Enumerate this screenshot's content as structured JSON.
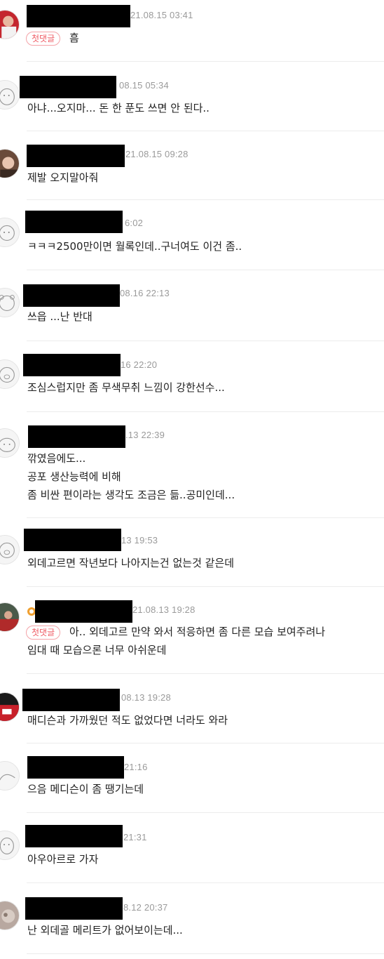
{
  "badge_label": "첫댓글",
  "comments": [
    {
      "time": "21.08.15 03:41",
      "first_comment": true,
      "text": "흠"
    },
    {
      "time": "08.15 05:34",
      "text": "아냐...오지마... 돈 한 푼도 쓰면 안 된다.."
    },
    {
      "time": "21.08.15 09:28",
      "text": "제발 오지말아줘"
    },
    {
      "time": "6:02",
      "text": "ㅋㅋㅋ2500만이면 월록인데..구너여도 이건 좀.."
    },
    {
      "time": "08.16 22:13",
      "text": "쓰읍 ...난 반대"
    },
    {
      "time": "16 22:20",
      "text": "조심스럽지만 좀 무색무취 느낌이 강한선수..."
    },
    {
      "time": ".13 22:39",
      "lines": [
        "깎였음에도...",
        "공포 생산능력에 비해",
        "좀 비싼 편이라는 생각도 조금은 듦..공미인데..."
      ]
    },
    {
      "time": "13 19:53",
      "text": "외데고르면 작년보다 나아지는건 없는것 같은데"
    },
    {
      "time": "21.08.13 19:28",
      "first_comment": true,
      "text": "아.. 외데고르 만약 와서 적응하면 좀 다른 모습 보여주려나",
      "text2": "임대 때 모습으론 너무 아쉬운데"
    },
    {
      "time": "08.13 19:28",
      "text": "매디슨과 가까웠던 적도 없었다면 너라도 와라"
    },
    {
      "time": "21:16",
      "text": "으음 메디슨이 좀 땡기는데"
    },
    {
      "time": "21:31",
      "text": "아우아르로 가자"
    },
    {
      "time": "8.12 20:37",
      "text": "난 외데골 메리트가 없어보이는데..."
    }
  ]
}
